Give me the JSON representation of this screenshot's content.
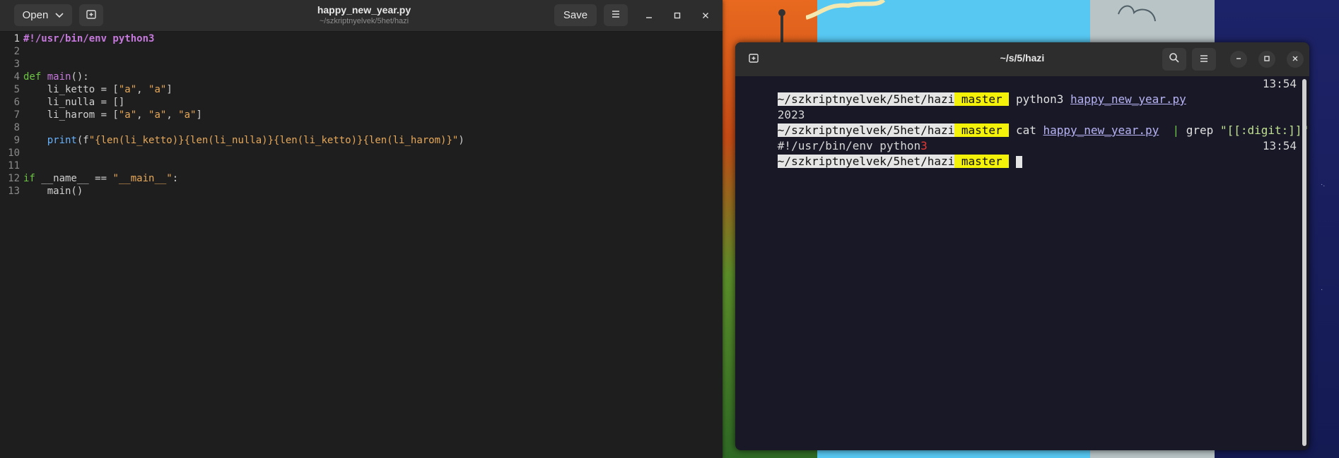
{
  "editor": {
    "open_label": "Open",
    "save_label": "Save",
    "title": "happy_new_year.py",
    "subtitle": "~/szkriptnyelvek/5het/hazi",
    "lines": [
      {
        "n": "1"
      },
      {
        "n": "2"
      },
      {
        "n": "3"
      },
      {
        "n": "4"
      },
      {
        "n": "5"
      },
      {
        "n": "6"
      },
      {
        "n": "7"
      },
      {
        "n": "8"
      },
      {
        "n": "9"
      },
      {
        "n": "10"
      },
      {
        "n": "11"
      },
      {
        "n": "12"
      },
      {
        "n": "13"
      }
    ],
    "code": {
      "shebang": "#!/usr/bin/env python3",
      "def_kw": "def",
      "main_name": "main",
      "def_rest": "():",
      "l5_a": "    li_ketto = [",
      "l5_s1": "\"a\"",
      "l5_b": ", ",
      "l5_s2": "\"a\"",
      "l5_c": "]",
      "l6": "    li_nulla = []",
      "l7_a": "    li_harom = [",
      "l7_s1": "\"a\"",
      "l7_b": ", ",
      "l7_s2": "\"a\"",
      "l7_c": ", ",
      "l7_s3": "\"a\"",
      "l7_d": "]",
      "l9_indent": "    ",
      "l9_print": "print",
      "l9_open": "(f",
      "l9_str": "\"{len(li_ketto)}{len(li_nulla)}{len(li_ketto)}{len(li_harom)}\"",
      "l9_close": ")",
      "l12_kw": "if",
      "l12_a": " __name__ == ",
      "l12_str": "\"__main__\"",
      "l12_b": ":",
      "l13": "    main()"
    }
  },
  "terminal": {
    "title": "~/s/5/hazi",
    "prompt_path": "~/szkriptnyelvek/5het/hazi",
    "prompt_branch": " master ",
    "line1_cmd": " python3 ",
    "line1_file": "happy_new_year.py",
    "line1_time": "13:54",
    "line2_output": "2023",
    "line3_cmd": " cat ",
    "line3_file": "happy_new_year.py",
    "line3_pipe": "  | ",
    "line3_grep": "grep ",
    "line3_pattern": "\"[[:digit:]]\"",
    "line4_text": "#!/usr/bin/env python",
    "line4_match": "3",
    "line5_time": "13:54"
  },
  "colors": {
    "branch_highlight": "#f5f20a",
    "match_red": "#e53935",
    "keyword_green": "#6cc644"
  }
}
